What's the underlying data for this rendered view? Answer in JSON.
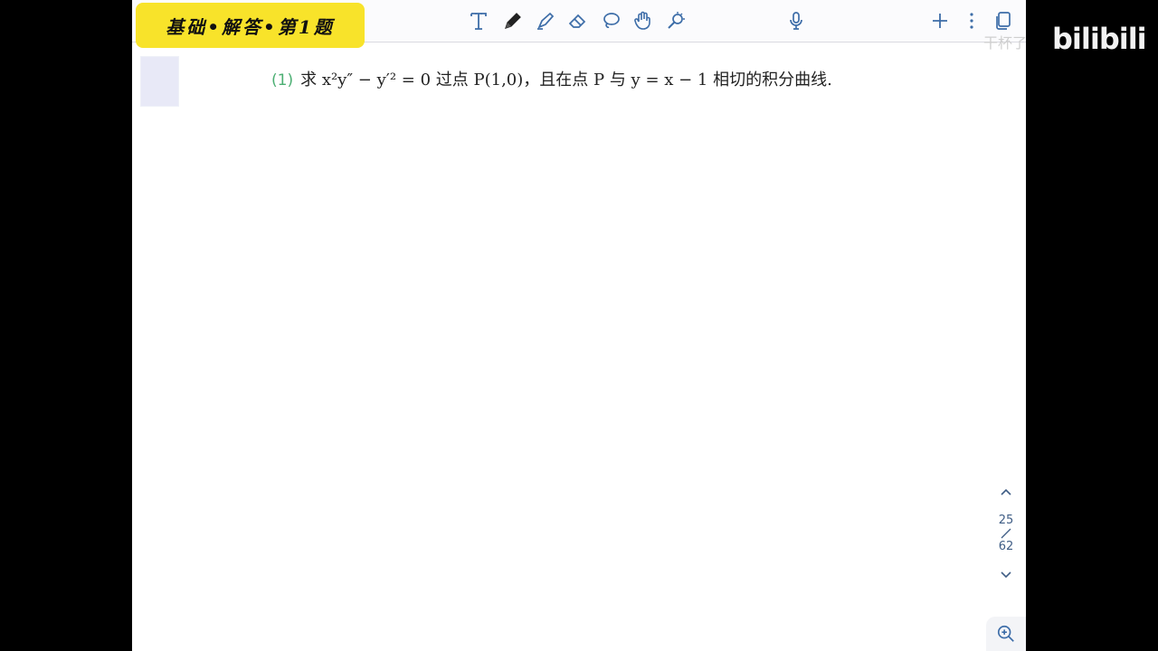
{
  "badge": {
    "text": "基础•解答•第1题"
  },
  "toolbar": {
    "tools": [
      {
        "name": "text-tool-icon"
      },
      {
        "name": "pen-tool-icon"
      },
      {
        "name": "highlighter-tool-icon"
      },
      {
        "name": "eraser-tool-icon"
      },
      {
        "name": "lasso-tool-icon"
      },
      {
        "name": "hand-tool-icon"
      },
      {
        "name": "laser-pointer-icon"
      },
      {
        "name": "microphone-icon"
      },
      {
        "name": "add-icon"
      },
      {
        "name": "more-options-icon"
      },
      {
        "name": "pages-icon"
      }
    ],
    "accent": "#3d6da8"
  },
  "problem": {
    "number": "(1)",
    "text_prefix": "求 x²y″ − y′² = 0 过点 P(1,0)，且在点 P 与 y = x − 1 相切的积分曲线."
  },
  "pager": {
    "current": "25",
    "total": "62"
  },
  "watermark": {
    "text": "干杯了",
    "logo": "bilibili"
  }
}
